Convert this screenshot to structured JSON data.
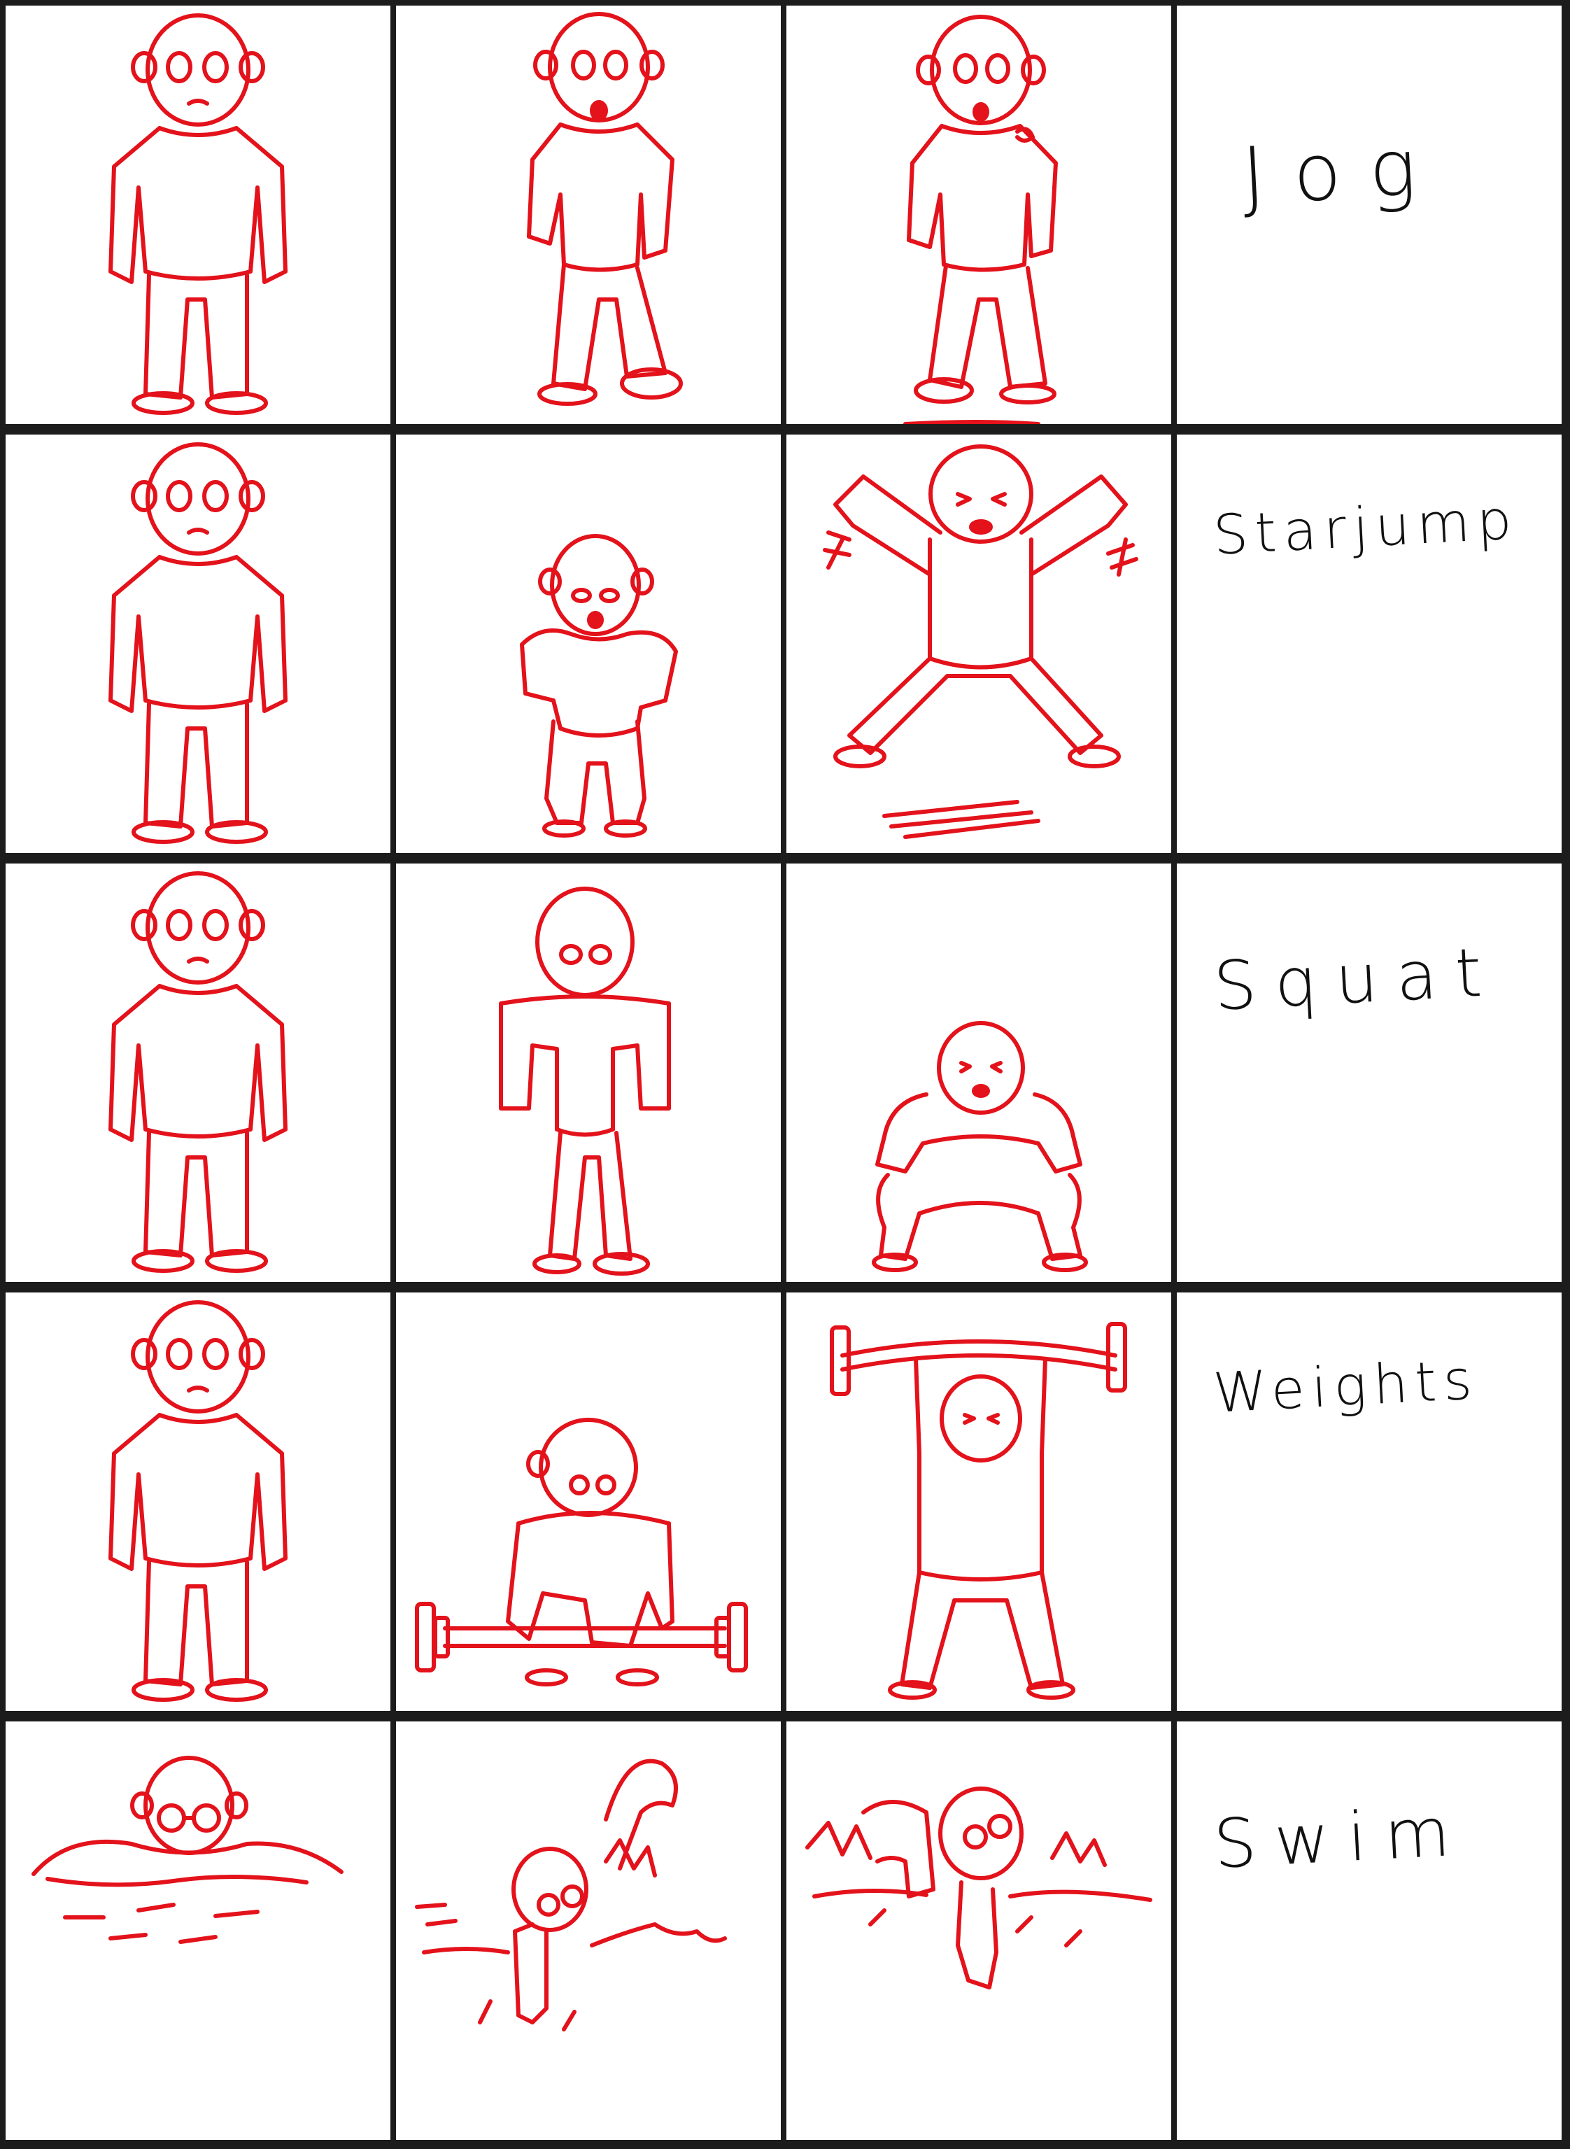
{
  "exercises": [
    {
      "label": "Jog"
    },
    {
      "label": "Starjump"
    },
    {
      "label": "Squat"
    },
    {
      "label": "Weights"
    },
    {
      "label": "Swim"
    }
  ],
  "colors": {
    "drawing": "#e3121b",
    "border": "#1c1c1c",
    "panel": "#ffffff",
    "label": "#111111"
  }
}
